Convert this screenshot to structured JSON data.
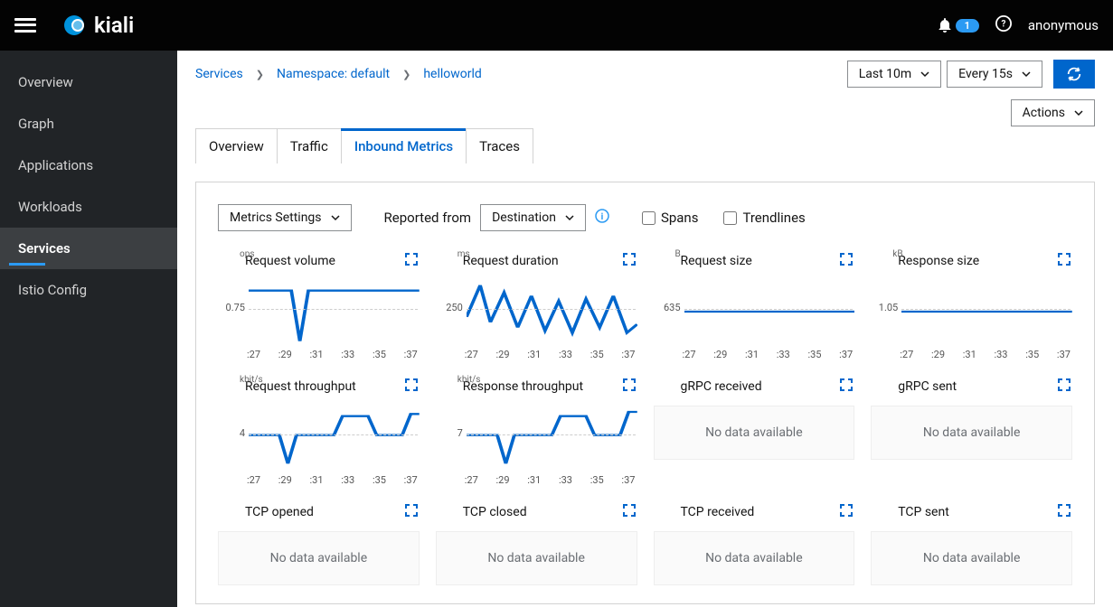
{
  "header": {
    "brand": "kiali",
    "notification_count": "1",
    "user": "anonymous"
  },
  "sidebar": {
    "items": [
      {
        "label": "Overview"
      },
      {
        "label": "Graph"
      },
      {
        "label": "Applications"
      },
      {
        "label": "Workloads"
      },
      {
        "label": "Services"
      },
      {
        "label": "Istio Config"
      }
    ],
    "active_index": 4
  },
  "breadcrumb": {
    "l0": "Services",
    "l1": "Namespace: default",
    "l2": "helloworld"
  },
  "top_controls": {
    "time_range": "Last 10m",
    "refresh_interval": "Every 15s",
    "actions": "Actions"
  },
  "tabs": {
    "items": [
      "Overview",
      "Traffic",
      "Inbound Metrics",
      "Traces"
    ],
    "active_index": 2
  },
  "panel_toolbar": {
    "metrics_settings": "Metrics Settings",
    "reported_from_label": "Reported from",
    "reported_from_value": "Destination",
    "spans": "Spans",
    "trendlines": "Trendlines"
  },
  "charts": {
    "x_ticks": [
      ":27",
      ":29",
      ":31",
      ":33",
      ":35",
      ":37"
    ],
    "no_data": "No data available",
    "items": [
      {
        "title": "Request volume",
        "unit": "ops",
        "y_tick": "0.75",
        "type": "line",
        "series_key": "request_volume"
      },
      {
        "title": "Request duration",
        "unit": "ms",
        "y_tick": "250",
        "type": "line",
        "series_key": "request_duration"
      },
      {
        "title": "Request size",
        "unit": "B",
        "y_tick": "635",
        "type": "flat"
      },
      {
        "title": "Response size",
        "unit": "kB",
        "y_tick": "1.05",
        "type": "flat"
      },
      {
        "title": "Request throughput",
        "unit": "kbit/s",
        "y_tick": "4",
        "type": "line",
        "series_key": "request_throughput"
      },
      {
        "title": "Response throughput",
        "unit": "kbit/s",
        "y_tick": "7",
        "type": "line",
        "series_key": "response_throughput"
      },
      {
        "title": "gRPC received",
        "unit": "",
        "y_tick": "",
        "type": "nodata"
      },
      {
        "title": "gRPC sent",
        "unit": "",
        "y_tick": "",
        "type": "nodata"
      },
      {
        "title": "TCP opened",
        "unit": "",
        "y_tick": "",
        "type": "nodata"
      },
      {
        "title": "TCP closed",
        "unit": "",
        "y_tick": "",
        "type": "nodata"
      },
      {
        "title": "TCP received",
        "unit": "",
        "y_tick": "",
        "type": "nodata"
      },
      {
        "title": "TCP sent",
        "unit": "",
        "y_tick": "",
        "type": "nodata"
      }
    ]
  },
  "chart_data": [
    {
      "type": "line",
      "title": "Request volume",
      "ylabel": "ops",
      "x": [
        ":27",
        ":28",
        ":29",
        ":30",
        ":31",
        ":32",
        ":33",
        ":34",
        ":35",
        ":36",
        ":37"
      ],
      "series": [
        {
          "name": "request_volume",
          "values": [
            1.0,
            1.0,
            1.0,
            0.1,
            1.0,
            1.0,
            1.0,
            1.0,
            1.0,
            1.0,
            1.0
          ]
        }
      ],
      "y_tick_shown": 0.75
    },
    {
      "type": "line",
      "title": "Request duration",
      "ylabel": "ms",
      "x": [
        ":27",
        ":28",
        ":29",
        ":30",
        ":31",
        ":32",
        ":33",
        ":34",
        ":35",
        ":36",
        ":37"
      ],
      "series": [
        {
          "name": "request_duration",
          "values": [
            230,
            350,
            200,
            320,
            180,
            300,
            170,
            260,
            160,
            280,
            150
          ]
        }
      ],
      "y_tick_shown": 250
    },
    {
      "type": "line",
      "title": "Request size",
      "ylabel": "B",
      "x": [
        ":27",
        ":28",
        ":29",
        ":30",
        ":31",
        ":32",
        ":33",
        ":34",
        ":35",
        ":36",
        ":37"
      ],
      "series": [
        {
          "name": "request_size",
          "values": [
            635,
            635,
            635,
            635,
            635,
            635,
            635,
            635,
            635,
            635,
            635
          ]
        }
      ],
      "y_tick_shown": 635
    },
    {
      "type": "line",
      "title": "Response size",
      "ylabel": "kB",
      "x": [
        ":27",
        ":28",
        ":29",
        ":30",
        ":31",
        ":32",
        ":33",
        ":34",
        ":35",
        ":36",
        ":37"
      ],
      "series": [
        {
          "name": "response_size",
          "values": [
            1.05,
            1.05,
            1.05,
            1.05,
            1.05,
            1.05,
            1.05,
            1.05,
            1.05,
            1.05,
            1.05
          ]
        }
      ],
      "y_tick_shown": 1.05
    },
    {
      "type": "line",
      "title": "Request throughput",
      "ylabel": "kbit/s",
      "x": [
        ":27",
        ":28",
        ":29",
        ":30",
        ":31",
        ":32",
        ":33",
        ":34",
        ":35",
        ":36",
        ":37"
      ],
      "series": [
        {
          "name": "request_throughput",
          "values": [
            4.3,
            4.3,
            2.0,
            4.3,
            4.3,
            4.3,
            5.5,
            5.5,
            4.3,
            4.3,
            5.8
          ]
        }
      ],
      "y_tick_shown": 4
    },
    {
      "type": "line",
      "title": "Response throughput",
      "ylabel": "kbit/s",
      "x": [
        ":27",
        ":28",
        ":29",
        ":30",
        ":31",
        ":32",
        ":33",
        ":34",
        ":35",
        ":36",
        ":37"
      ],
      "series": [
        {
          "name": "response_throughput",
          "values": [
            7.3,
            7.3,
            3.5,
            7.3,
            7.3,
            7.3,
            9.0,
            9.0,
            7.3,
            7.3,
            9.5
          ]
        }
      ],
      "y_tick_shown": 7
    }
  ]
}
